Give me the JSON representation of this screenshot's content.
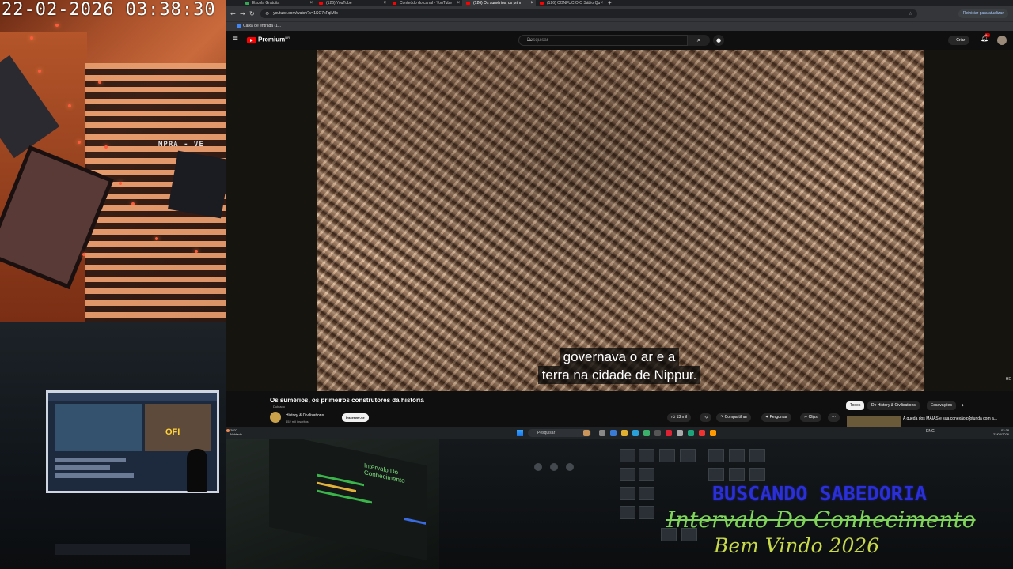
{
  "overlay_stream": {
    "timestamp": "22-02-2026 03:38:30",
    "line1": "BUSCANDO SABEDORIA",
    "line2": "Intervalo Do Conhecimento",
    "line3": "Bem Vindo 2026",
    "cam_sign": "MPRA - VE",
    "room_monitor_badge": "OFI",
    "studio_screen_label": "Intervalo Do Conhecimento"
  },
  "browser": {
    "tabs": [
      {
        "label": "Escola Gratuita",
        "active": false
      },
      {
        "label": "(126) YouTube",
        "active": false
      },
      {
        "label": "Conteúdo do canal - YouTube",
        "active": false
      },
      {
        "label": "(126) Os sumérios, os prim",
        "active": true
      },
      {
        "label": "(126) CONFUCIO O Sábio Qu",
        "active": false
      }
    ],
    "new_tab": "+",
    "url": "youtube.com/watch?v=1SG7xFqlMIo",
    "restart_label": "Reiniciar para atualizar",
    "bookmark": "Caixa de entrada (1...",
    "nav_icons": [
      "back-icon",
      "forward-icon",
      "reload-icon"
    ]
  },
  "youtube": {
    "brand": "Premium",
    "brand_sup": "BR",
    "search_placeholder": "Pesquisar",
    "create_label": "+ Criar",
    "notifications": "9+",
    "video": {
      "subtitle_line1": "governava o ar e a",
      "subtitle_line2": "terra na cidade de Nippur.",
      "quality_badge": "HD"
    },
    "title": "Os sumérios, os primeiros construtores da história",
    "dubbed": "Dublado",
    "channel": "History & Civilisations",
    "subscribers": "452 mil inscritos",
    "subscribe_label": "Inscrever-se",
    "actions": {
      "like": "13 mil",
      "share": "Compartilhar",
      "ask": "Perguntar",
      "clips": "Clips",
      "more": "···"
    },
    "chips": [
      "Todos",
      "De History & Civilisations",
      "Escavações"
    ],
    "recommended_title": "A queda dos MAIAS e sua conexão profunda com a..."
  },
  "taskbar": {
    "weather_temp": "20°C",
    "weather_cond": "Nublado",
    "search_label": "Pesquisar",
    "tray_lang": "ENG",
    "time": "03:38",
    "date": "22/02/2026"
  }
}
